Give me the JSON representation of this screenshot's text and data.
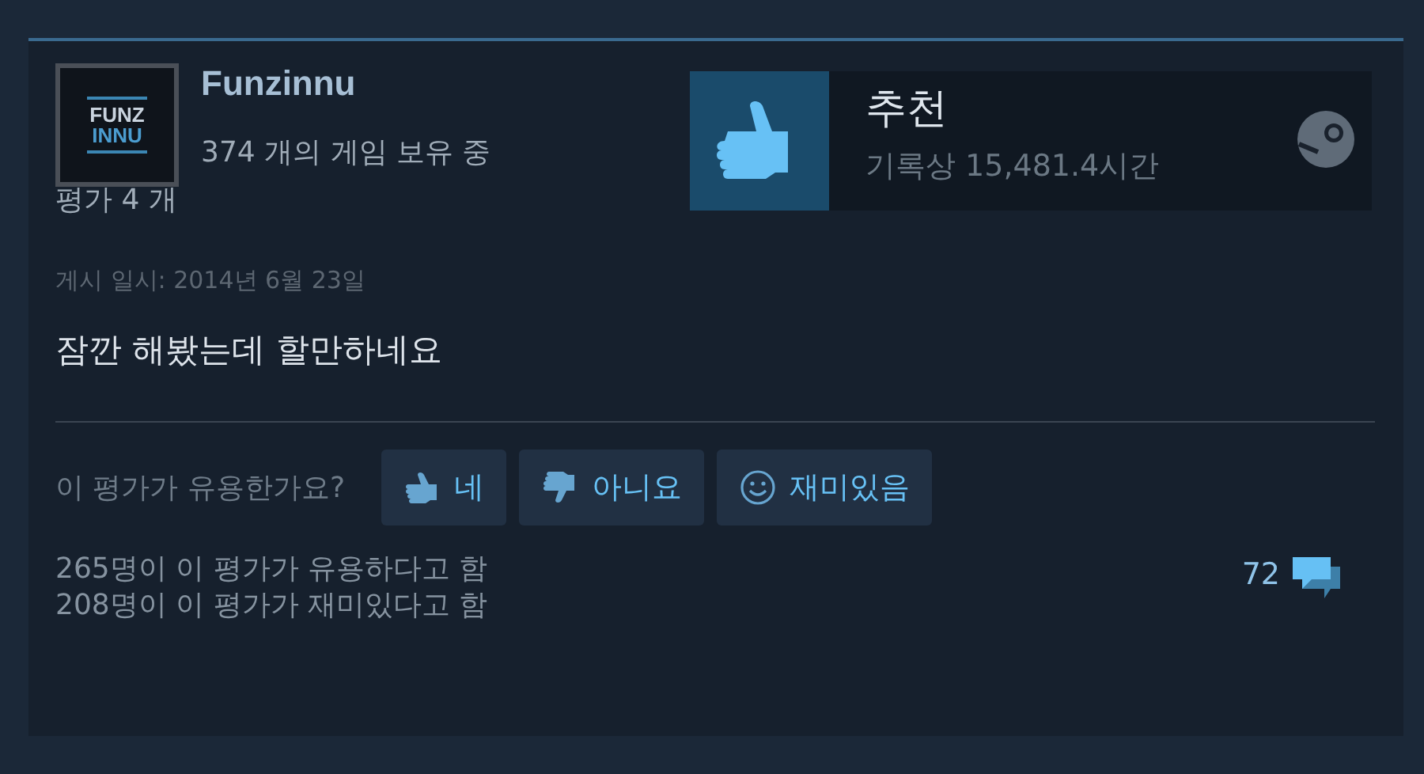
{
  "author": {
    "avatar_text": [
      "FUNZ",
      "INNU"
    ],
    "name": "Funzinnu",
    "games_owned": "374 개의 게임 보유 중",
    "reviews": "평가 4 개"
  },
  "verdict": {
    "title": "추천",
    "hours": "기록상 15,481.4시간"
  },
  "posted": "게시 일시: 2014년 6월 23일",
  "body": "잠깐 해봤는데 할만하네요",
  "helpful_prompt": "이 평가가 유용한가요?",
  "vote_buttons": [
    {
      "kind": "thumb-up",
      "label": "네"
    },
    {
      "kind": "thumb-down",
      "label": "아니요"
    },
    {
      "kind": "smile",
      "label": "재미있음"
    }
  ],
  "stats": [
    "265명이 이 평가가 유용하다고 함",
    "208명이 이 평가가 재미있다고 함"
  ],
  "comments": "72"
}
